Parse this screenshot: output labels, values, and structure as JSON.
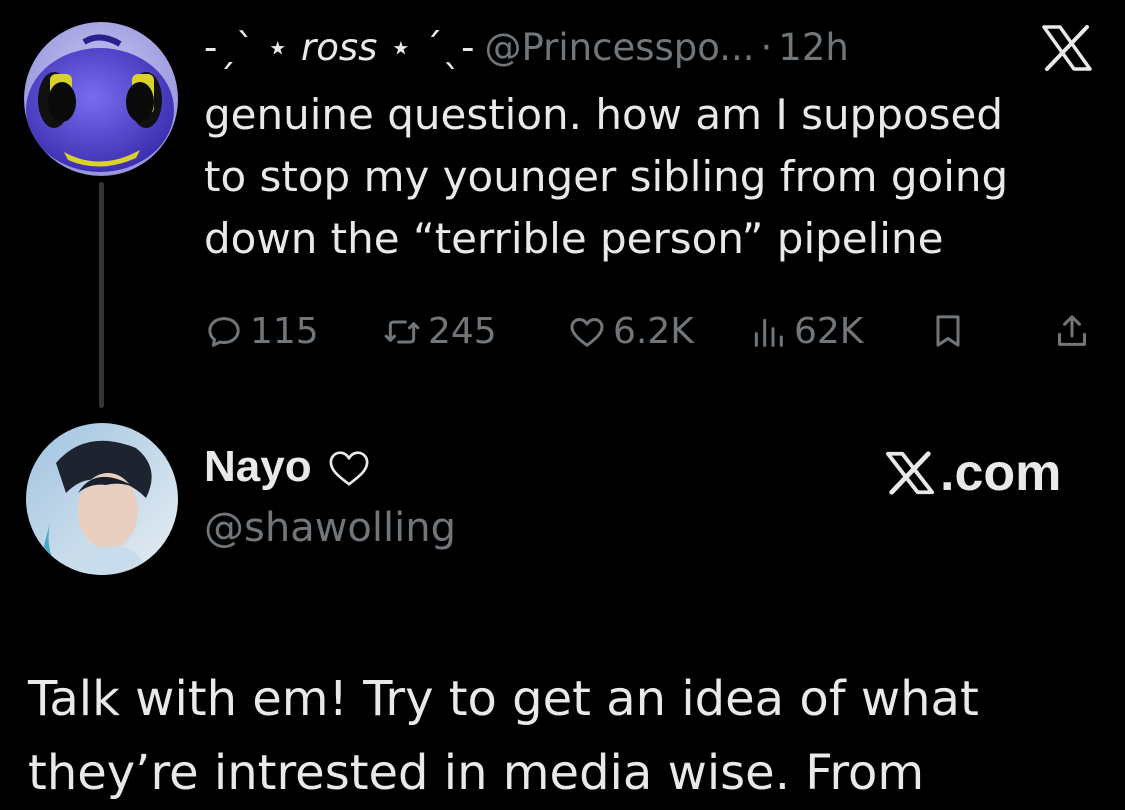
{
  "parent_tweet": {
    "display_name_prefix": "-ˏˋ ⋆",
    "display_name_main": "ross",
    "display_name_suffix": "⋆ ˊˎ-",
    "handle": "@Princesspo...",
    "separator": "·",
    "time": "12h",
    "text_lines": [
      "genuine question. how am I supposed",
      "to stop my younger sibling from going",
      "down the “terrible person” pipeline"
    ],
    "stats": {
      "replies": "115",
      "retweets": "245",
      "likes": "6.2K",
      "views": "62K"
    }
  },
  "reply": {
    "display_name": "Nayo",
    "handle": "@shawolling",
    "brand": ".com",
    "text_lines": [
      "Talk with em! Try to get an idea of what",
      "they’re intrested in media wise. From"
    ]
  },
  "colors": {
    "background": "#000000",
    "primary_text": "#e7e9ea",
    "secondary_text": "#71767b",
    "thread_line": "#333639"
  },
  "icons": [
    "reply-icon",
    "retweet-icon",
    "like-icon",
    "views-icon",
    "bookmark-icon",
    "share-icon",
    "x-logo-icon",
    "heart-icon"
  ]
}
